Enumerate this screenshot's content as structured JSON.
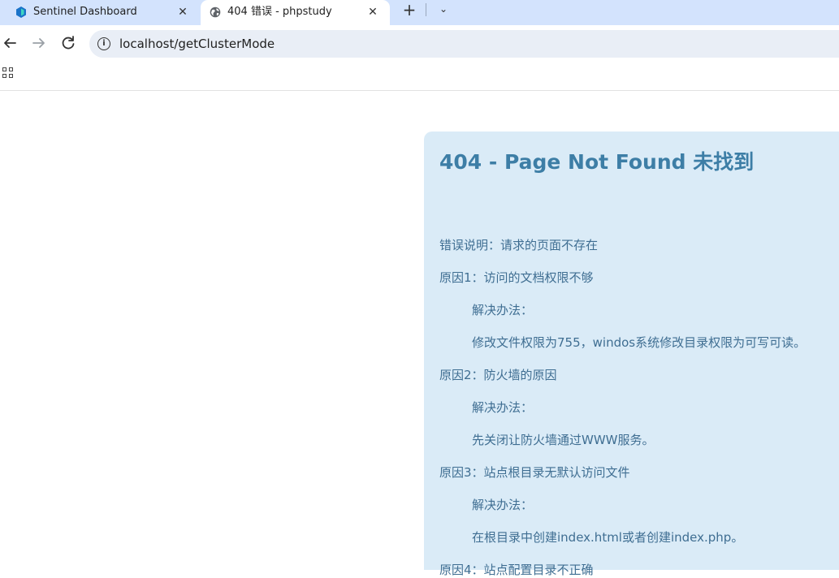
{
  "browser": {
    "tabs": [
      {
        "title": "Sentinel Dashboard",
        "icon": "sentinel-icon",
        "active": false
      },
      {
        "title": "404 错误 - phpstudy",
        "icon": "globe-icon",
        "active": true
      }
    ],
    "new_tab_symbol": "+",
    "tab_menu_symbol": "⌄",
    "close_symbol": "✕",
    "url": "localhost/getClusterMode"
  },
  "page": {
    "title": "404 - Page Not Found 未找到",
    "lines": [
      "错误说明：请求的页面不存在",
      "原因1：访问的文档权限不够",
      "解决办法：",
      "修改文件权限为755，windos系统修改目录权限为可写可读。",
      "原因2：防火墙的原因",
      "解决办法：",
      "先关闭让防火墙通过WWW服务。",
      "原因3：站点根目录无默认访问文件",
      "解决办法：",
      "在根目录中创建index.html或者创建index.php。",
      "原因4：站点配置目录不正确"
    ]
  },
  "colors": {
    "tabbar_bg": "#d3e3fd",
    "omnibox_bg": "#e9eef6",
    "panel_bg": "#daebf7",
    "title_color": "#3d7ea6",
    "text_color": "#3f6e92"
  }
}
